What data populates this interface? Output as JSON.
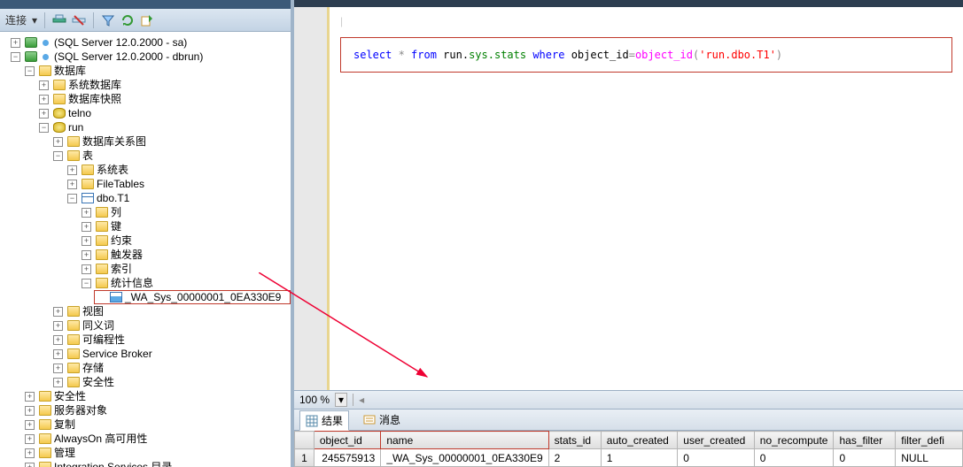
{
  "toolbar": {
    "connect_label": "连接",
    "dropdown": "▾"
  },
  "tree": {
    "srv1": "(SQL Server 12.0.2000 - sa)",
    "srv2": "(SQL Server 12.0.2000 - dbrun)",
    "databases": "数据库",
    "sys_db": "系统数据库",
    "db_snap": "数据库快照",
    "telno": "telno",
    "run": "run",
    "db_diag": "数据库关系图",
    "tables": "表",
    "sys_tables": "系统表",
    "filetables": "FileTables",
    "dbo_t1": "dbo.T1",
    "cols": "列",
    "keys": "键",
    "constraints": "约束",
    "triggers": "触发器",
    "indexes": "索引",
    "stats": "统计信息",
    "stat_item": "_WA_Sys_00000001_0EA330E9",
    "views": "视图",
    "synonyms": "同义词",
    "programmability": "可编程性",
    "service_broker": "Service Broker",
    "storage": "存储",
    "security_inner": "安全性",
    "security": "安全性",
    "server_objects": "服务器对象",
    "replication": "复制",
    "alwayson": "AlwaysOn 高可用性",
    "management": "管理",
    "integ_svcs": "Integration Services 目录"
  },
  "editor": {
    "sql_parts": {
      "select": "select",
      "star": " * ",
      "from": "from",
      "run_dot": " run.",
      "sys_stats": "sys.stats",
      "where": " where ",
      "objid": "object_id",
      "eq": "=",
      "fn_objid": "object_id",
      "lp": "(",
      "str": "'run.dbo.T1'",
      "rp": ")"
    }
  },
  "zoom": "100 %",
  "results_tabs": {
    "results": "结果",
    "messages": "消息"
  },
  "grid": {
    "columns": [
      "object_id",
      "name",
      "stats_id",
      "auto_created",
      "user_created",
      "no_recompute",
      "has_filter",
      "filter_defi"
    ],
    "rows": [
      {
        "n": "1",
        "object_id": "245575913",
        "name": "_WA_Sys_00000001_0EA330E9",
        "stats_id": "2",
        "auto_created": "1",
        "user_created": "0",
        "no_recompute": "0",
        "has_filter": "0",
        "filter_defi": "NULL"
      }
    ]
  }
}
